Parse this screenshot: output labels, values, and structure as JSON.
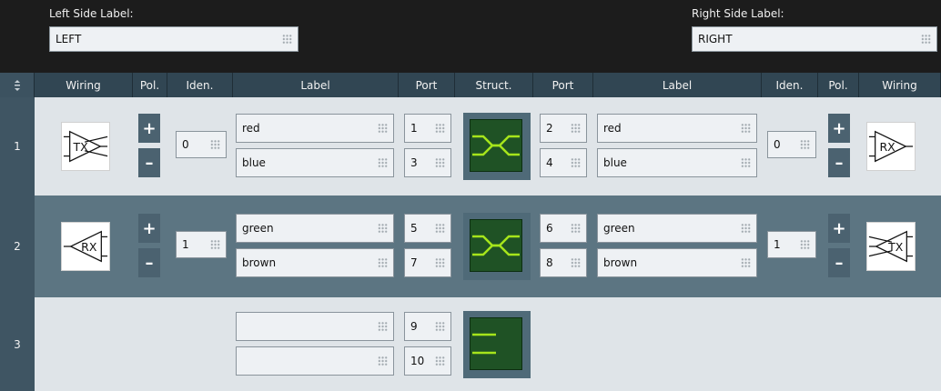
{
  "left_side": {
    "label": "Left Side Label:",
    "value": "LEFT"
  },
  "right_side": {
    "label": "Right Side Label:",
    "value": "RIGHT"
  },
  "headers": [
    "Wiring",
    "Pol.",
    "Iden.",
    "Label",
    "Port",
    "Struct.",
    "Port",
    "Label",
    "Iden.",
    "Pol.",
    "Wiring"
  ],
  "sort_icon": "sort-handle-icon",
  "rows": [
    {
      "num": "1",
      "left_wiring": "TX",
      "left_iden": "0",
      "left_labels": [
        "red",
        "blue"
      ],
      "left_ports": [
        "1",
        "3"
      ],
      "right_ports": [
        "2",
        "4"
      ],
      "right_labels": [
        "red",
        "blue"
      ],
      "right_iden": "0",
      "right_wiring": "RX"
    },
    {
      "num": "2",
      "left_wiring": "RX",
      "left_iden": "1",
      "left_labels": [
        "green",
        "brown"
      ],
      "left_ports": [
        "5",
        "7"
      ],
      "right_ports": [
        "6",
        "8"
      ],
      "right_labels": [
        "green",
        "brown"
      ],
      "right_iden": "1",
      "right_wiring": "TX"
    },
    {
      "num": "3",
      "left_labels": [
        "",
        ""
      ],
      "left_ports": [
        "9",
        "10"
      ]
    }
  ],
  "buttons": {
    "plus": "+",
    "minus": "–"
  },
  "colors": {
    "row_light": "#dfe4e8",
    "row_dark": "#5c7582",
    "row_num_bg": "#3f5563",
    "header_bg": "#314653",
    "struct_line": "#a6e51b"
  }
}
